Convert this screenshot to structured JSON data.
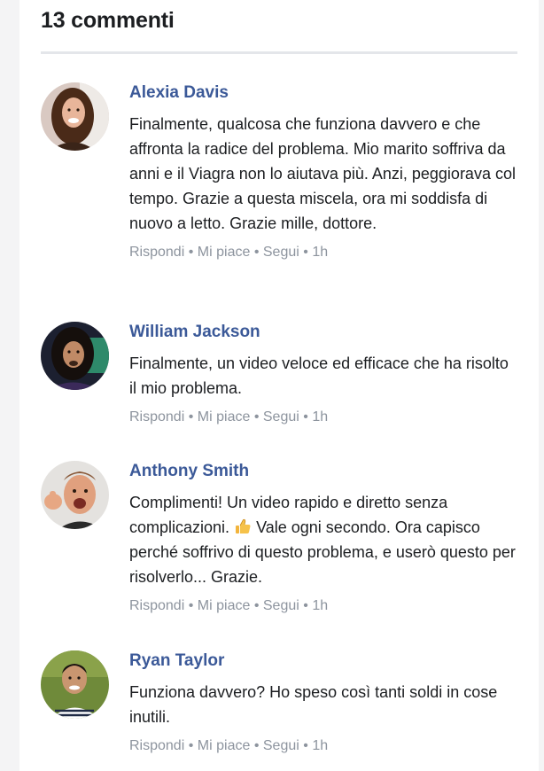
{
  "header": {
    "title": "13 commenti"
  },
  "actions": {
    "reply": "Rispondi",
    "like": "Mi piace",
    "follow": "Segui",
    "separator": "•"
  },
  "comments": [
    {
      "name": "Alexia Davis",
      "text": "Finalmente, qualcosa che funziona davvero e che affronta la radice del problema. Mio marito soffriva da anni e il Viagra non lo aiutava più. Anzi, peggiorava col tempo. Grazie a questa miscela, ora mi soddisfa di nuovo a letto. Grazie mille, dottore.",
      "time": "1h",
      "avatar_icon": "woman-avatar-photo"
    },
    {
      "name": "William Jackson",
      "text": "Finalmente, un video veloce ed efficace che ha risolto il mio problema.",
      "time": "1h",
      "avatar_icon": "man-long-hair-avatar-photo"
    },
    {
      "name": "Anthony Smith",
      "text_before": "Complimenti! Un video rapido e diretto senza complicazioni.",
      "text_after": "Vale ogni secondo. Ora capisco perché soffrivo di questo problema, e userò questo per risolverlo... Grazie.",
      "emoji": "thumbs-up-icon",
      "time": "1h",
      "avatar_icon": "man-thumbs-up-avatar-photo"
    },
    {
      "name": "Ryan Taylor",
      "text": "Funziona davvero? Ho speso così tanti soldi in cose inutili.",
      "time": "1h",
      "avatar_icon": "man-striped-shirt-avatar-photo"
    }
  ]
}
